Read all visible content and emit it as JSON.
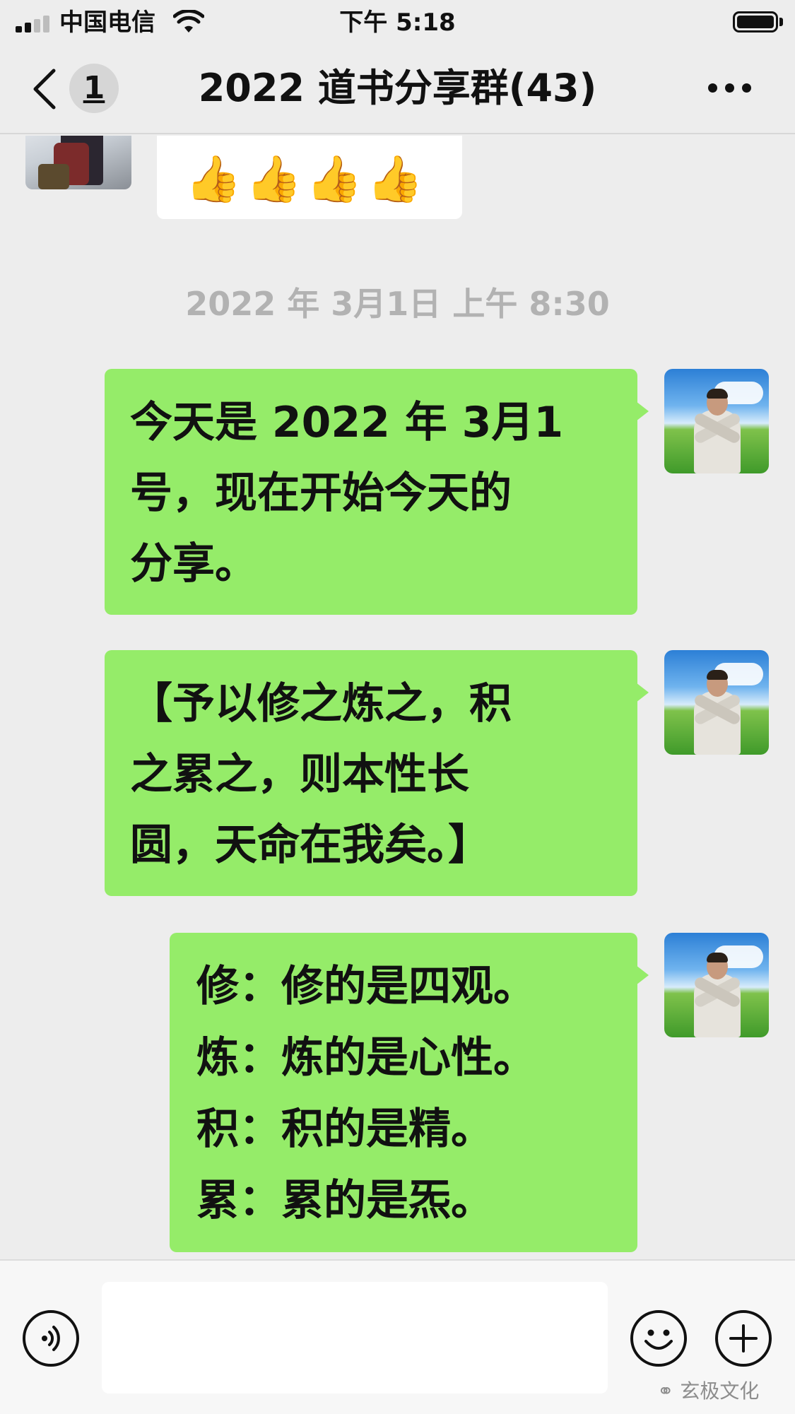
{
  "status_bar": {
    "carrier": "中国电信",
    "time": "下午 5:18"
  },
  "nav": {
    "unread_count": "1",
    "title": "2022 道书分享群(43)"
  },
  "chat": {
    "reaction_message": "👍👍👍👍",
    "timestamp": "2022 年 3月1日 上午 8:30",
    "messages": [
      {
        "text": "今天是 2022 年 3月1\n号，现在开始今天的\n分享。"
      },
      {
        "text": "【予以修之炼之，积\n之累之，则本性长\n圆，天命在我矣。】"
      },
      {
        "text": "修：修的是四观。\n炼：炼的是心性。\n积：积的是精。\n累：累的是炁。"
      }
    ]
  },
  "input_bar": {
    "value": "",
    "watermark": "玄极文化"
  },
  "colors": {
    "background": "#ededed",
    "self_bubble": "#95ec69",
    "other_bubble": "#ffffff",
    "timestamp_text": "#b2b2b2"
  },
  "icons": [
    "signal-icon",
    "wifi-icon",
    "battery-icon",
    "back-chevron-icon",
    "more-icon",
    "voice-icon",
    "emoji-icon",
    "plus-icon",
    "wechat-logo-icon"
  ]
}
